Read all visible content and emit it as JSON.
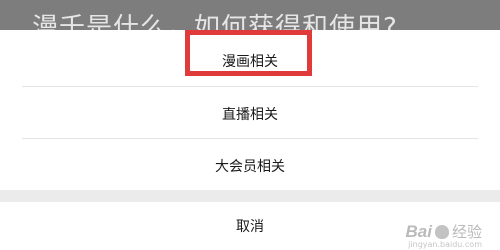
{
  "background": {
    "title": "漫千是什么，如何获得和使用?"
  },
  "action_sheet": {
    "items": [
      {
        "label": "漫画相关",
        "highlighted": true
      },
      {
        "label": "直播相关",
        "highlighted": false
      },
      {
        "label": "大会员相关",
        "highlighted": false
      }
    ],
    "cancel_label": "取消"
  },
  "highlight": {
    "color": "#e03a3a"
  },
  "watermark": {
    "logo": "Bai",
    "suffix": "经验",
    "url": "jingyan.baidu.com"
  }
}
